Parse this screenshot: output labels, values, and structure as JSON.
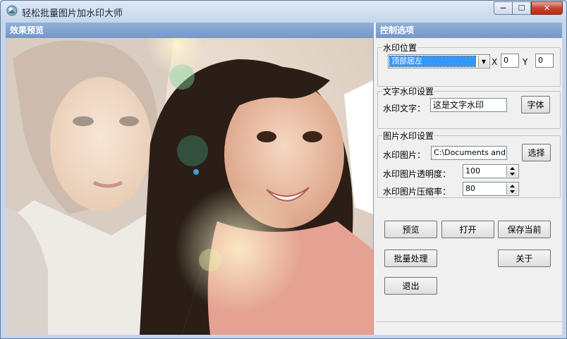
{
  "window": {
    "title": "轻松批量图片加水印大师",
    "minimize_label": "—",
    "maximize_label": "☐",
    "close_label": "✕"
  },
  "preview": {
    "header": "效果预览"
  },
  "controls": {
    "header": "控制选项",
    "position_group": {
      "legend": "水印位置",
      "selected_position": "顶部居左",
      "x_label": "X",
      "x_value": "0",
      "y_label": "Y",
      "y_value": "0"
    },
    "text_group": {
      "legend": "文字水印设置",
      "text_label": "水印文字：",
      "text_value": "这是文字水印",
      "font_button": "字体"
    },
    "image_group": {
      "legend": "图片水印设置",
      "image_label": "水印图片：",
      "image_path": "C:\\Documents and Se",
      "select_button": "选择",
      "opacity_label": "水印图片透明度：",
      "opacity_value": "100",
      "compression_label": "水印图片压缩率：",
      "compression_value": "80"
    },
    "buttons": {
      "preview": "预览",
      "open": "打开",
      "save_current": "保存当前",
      "batch": "批量处理",
      "about": "关于",
      "exit": "退出"
    }
  },
  "colors": {
    "header_blue": "#7598c6",
    "selection_blue": "#3399ff",
    "close_red": "#c6442c"
  }
}
